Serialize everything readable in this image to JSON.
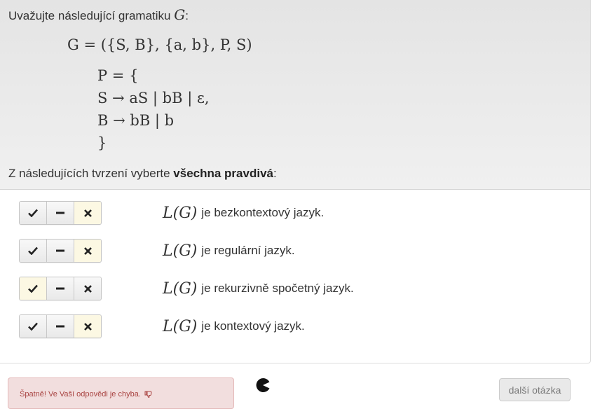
{
  "question": {
    "intro_text": "Uvažujte následující gramatiku ",
    "intro_symbol": "G",
    "intro_suffix": ":",
    "grammar_def": "G = ({S, B}, {a, b}, P, S)",
    "rules": {
      "open": "P = {",
      "rule_s": "S → aS | bB | ε,",
      "rule_b": "B → bB | b",
      "close": "}"
    },
    "prompt_text": "Z následujících tvrzení vyberte ",
    "prompt_bold": "všechna pravdivá",
    "prompt_suffix": ":"
  },
  "answers": [
    {
      "math": "L(G)",
      "text": "je bezkontextový jazyk.",
      "selected": "false"
    },
    {
      "math": "L(G)",
      "text": "je regulární jazyk.",
      "selected": "false"
    },
    {
      "math": "L(G)",
      "text": "je rekurzivně spočetný jazyk.",
      "selected": "true"
    },
    {
      "math": "L(G)",
      "text": "je kontextový jazyk.",
      "selected": "false"
    }
  ],
  "toggle_icons": [
    "check-icon",
    "minus-icon",
    "cross-icon"
  ],
  "feedback": {
    "text": "Špatně! Ve Vaší odpovědi je chyba.",
    "icon": "thumbs-down-icon"
  },
  "status_icon": "pacman-icon",
  "next_button": {
    "label": "další otázka"
  },
  "colors": {
    "header_bg": "#e8e8e8",
    "active_toggle_bg": "#fcf8e3",
    "error_bg": "#f2dede",
    "error_text": "#a94442"
  }
}
